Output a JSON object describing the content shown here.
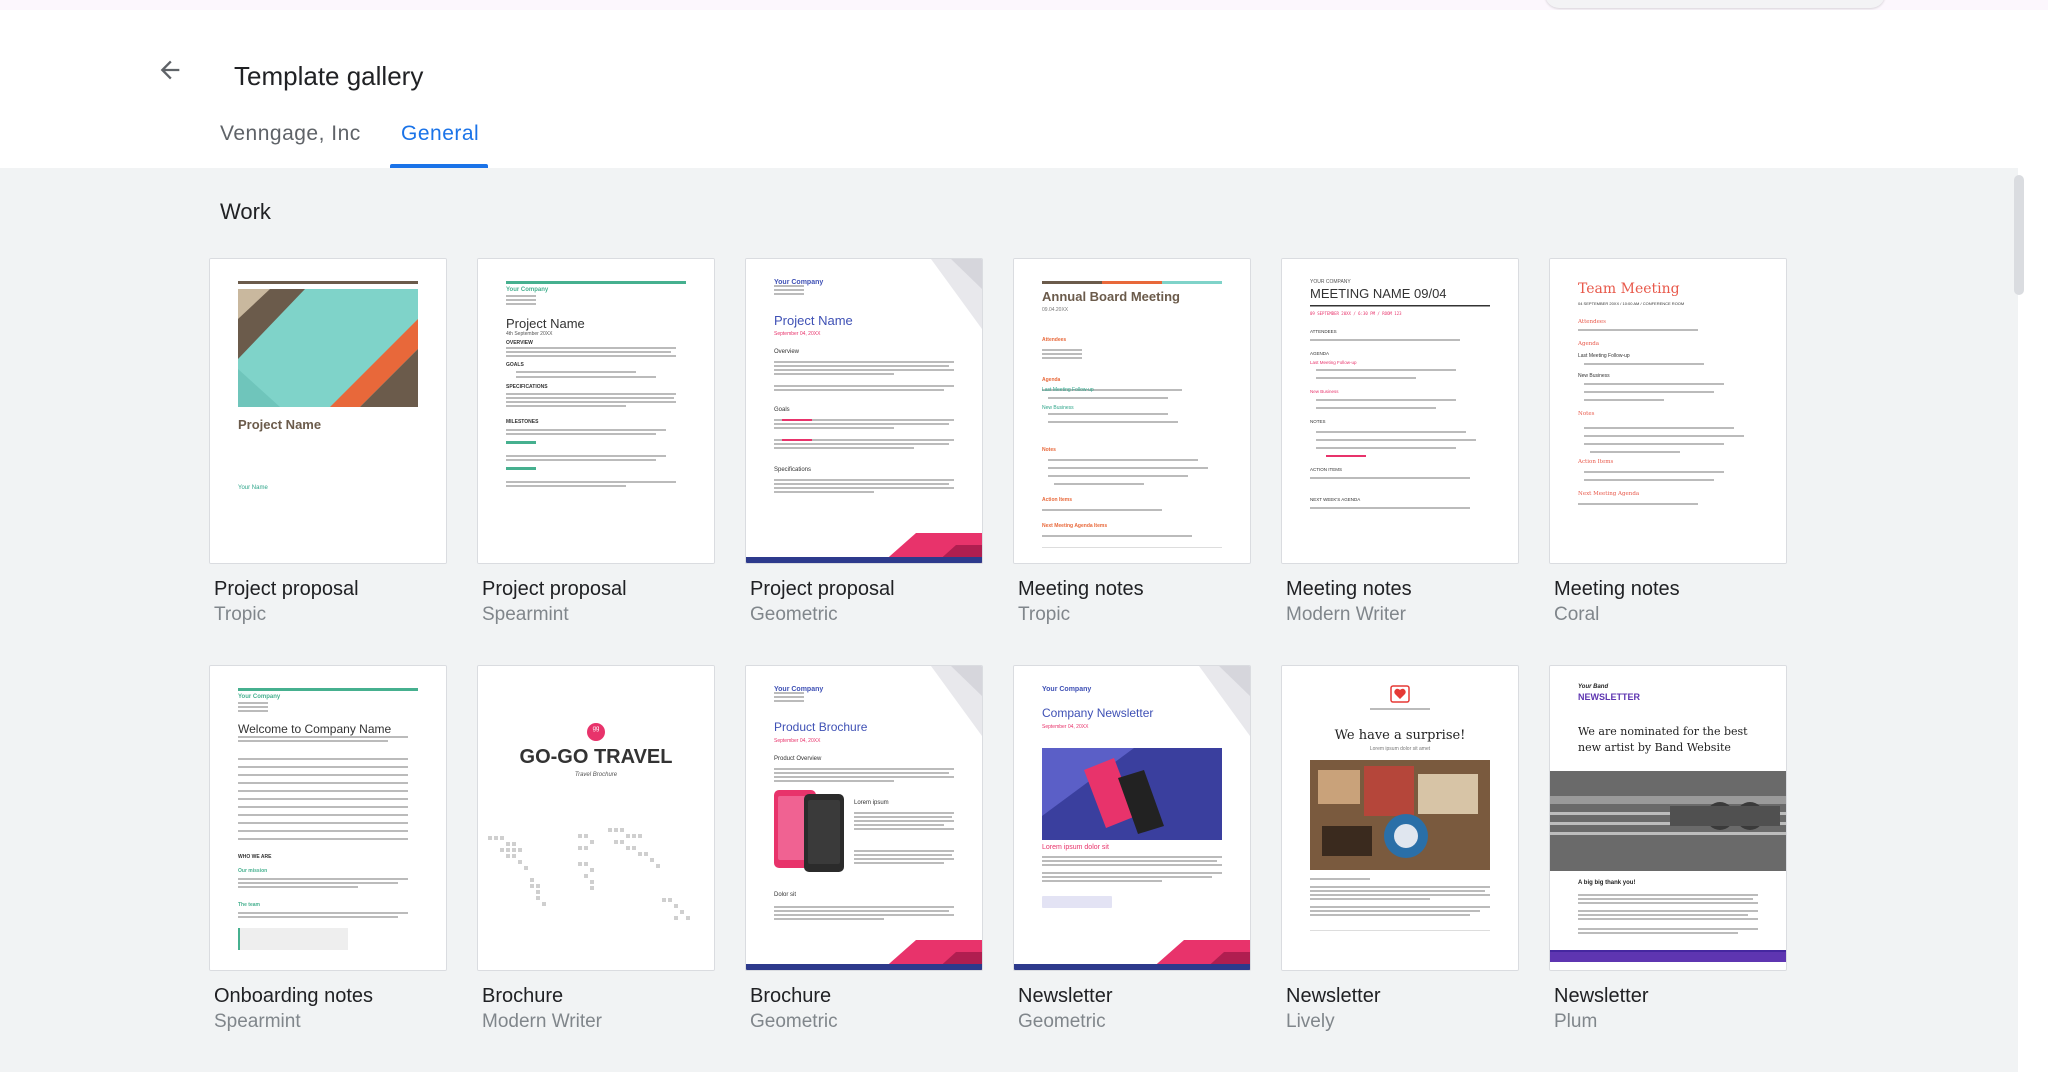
{
  "page_title": "Template gallery",
  "tabs": [
    {
      "label": "Venngage, Inc",
      "selected": false
    },
    {
      "label": "General",
      "selected": true
    }
  ],
  "section": {
    "title": "Work"
  },
  "accent_color": "#1a73e8",
  "templates": [
    {
      "name": "Project proposal",
      "style": "Tropic",
      "thumb": {
        "heading": "Project Name",
        "sub": "Your Name"
      }
    },
    {
      "name": "Project proposal",
      "style": "Spearmint",
      "thumb": {
        "company": "Your Company",
        "heading": "Project Name",
        "sub": "4th September 20XX",
        "sections": [
          "OVERVIEW",
          "GOALS",
          "SPECIFICATIONS",
          "MILESTONES"
        ]
      }
    },
    {
      "name": "Project proposal",
      "style": "Geometric",
      "thumb": {
        "company": "Your Company",
        "heading": "Project Name",
        "sub": "September 04, 20XX",
        "sections": [
          "Overview",
          "Goals",
          "Specifications"
        ]
      }
    },
    {
      "name": "Meeting notes",
      "style": "Tropic",
      "thumb": {
        "heading": "Annual Board Meeting",
        "sub": "09.04.20XX",
        "sections": [
          "Attendees",
          "Agenda",
          "Last Meeting Follow-up",
          "New Business",
          "Notes",
          "Action Items",
          "Next Meeting Agenda Items"
        ]
      }
    },
    {
      "name": "Meeting notes",
      "style": "Modern Writer",
      "thumb": {
        "company": "YOUR COMPANY",
        "heading": "MEETING NAME 09/04",
        "sub": "09 SEPTEMBER 20XX / 6:30 PM / ROOM 123",
        "sections": [
          "ATTENDEES",
          "AGENDA",
          "Last Meeting Follow-up",
          "New Business",
          "NOTES",
          "ACTION ITEMS",
          "NEXT WEEK'S AGENDA"
        ]
      }
    },
    {
      "name": "Meeting notes",
      "style": "Coral",
      "thumb": {
        "heading": "Team Meeting",
        "sub": "04 SEPTEMBER 20XX / 10:00 AM / CONFERENCE ROOM",
        "sections": [
          "Attendees",
          "Agenda",
          "Last Meeting Follow-up",
          "New Business",
          "Notes",
          "Action Items",
          "Next Meeting Agenda"
        ]
      }
    },
    {
      "name": "Onboarding notes",
      "style": "Spearmint",
      "thumb": {
        "company": "Your Company",
        "heading": "Welcome to Company Name",
        "sections": [
          "WHO WE ARE",
          "Our mission",
          "The team"
        ]
      }
    },
    {
      "name": "Brochure",
      "style": "Modern Writer",
      "thumb": {
        "heading": "GO-GO TRAVEL",
        "sub": "Travel Brochure",
        "logo": "gg"
      }
    },
    {
      "name": "Brochure",
      "style": "Geometric",
      "thumb": {
        "company": "Your Company",
        "heading": "Product Brochure",
        "sub": "September 04, 20XX",
        "sections": [
          "Product Overview",
          "Lorem ipsum",
          "Dolor sit"
        ]
      }
    },
    {
      "name": "Newsletter",
      "style": "Geometric",
      "thumb": {
        "company": "Your Company",
        "heading": "Company Newsletter",
        "sub": "September 04, 20XX",
        "caption": "Lorem ipsum dolor sit"
      }
    },
    {
      "name": "Newsletter",
      "style": "Lively",
      "thumb": {
        "heading": "We have a surprise!",
        "sub": "Lorem ipsum dolor sit amet"
      }
    },
    {
      "name": "Newsletter",
      "style": "Plum",
      "thumb": {
        "company": "Your Band",
        "label": "NEWSLETTER",
        "heading": "We are nominated for the best new artist by Band Website",
        "caption": "A big big thank you!"
      }
    }
  ]
}
